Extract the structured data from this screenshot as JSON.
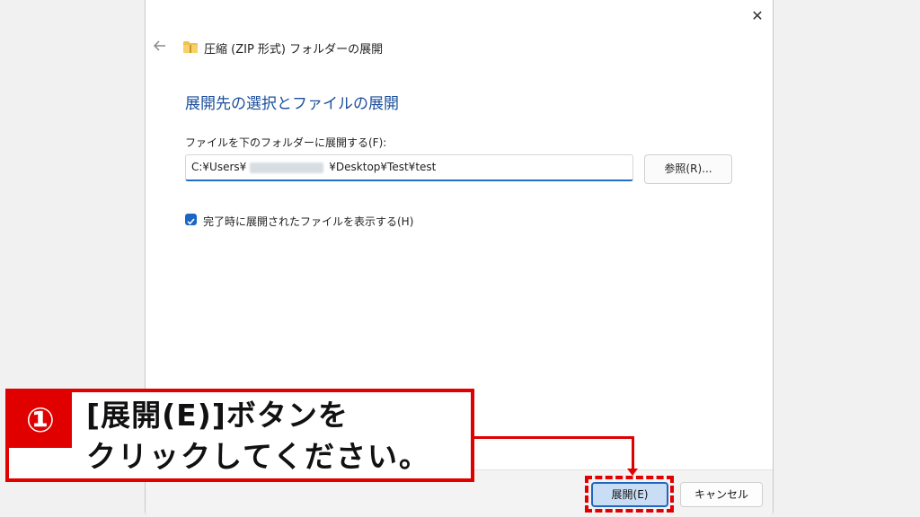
{
  "window": {
    "title": "圧縮 (ZIP 形式) フォルダーの展開",
    "close_glyph": "✕"
  },
  "main": {
    "heading": "展開先の選択とファイルの展開",
    "field_label": "ファイルを下のフォルダーに展開する(F):",
    "path_prefix": "C:¥Users¥",
    "path_suffix": "¥Desktop¥Test¥test",
    "browse_label": "参照(R)...",
    "show_files_checkbox": {
      "label": "完了時に展開されたファイルを表示する(H)",
      "checked": true
    }
  },
  "footer": {
    "extract_label": "展開(E)",
    "cancel_label": "キャンセル"
  },
  "annotation": {
    "step_number": "①",
    "line1": "[展開(E)]ボタンを",
    "line2": "クリックしてください。",
    "color": "#e00000"
  },
  "colors": {
    "accent": "#1f6fc4",
    "heading": "#1c4f9c",
    "folder": "#f2c14e"
  },
  "icons": {
    "back": "back-arrow-icon",
    "folder": "zip-folder-icon",
    "check": "checkmark-icon",
    "close": "close-icon"
  }
}
